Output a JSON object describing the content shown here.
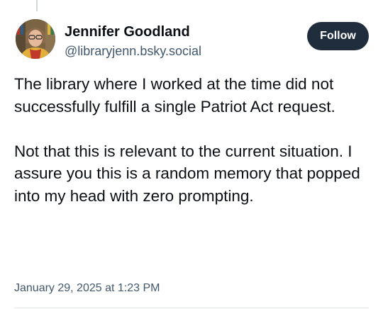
{
  "post": {
    "author": {
      "display_name": "Jennifer Goodland",
      "handle": "@libraryjenn.bsky.social",
      "avatar_icon": "user-avatar"
    },
    "follow_label": "Follow",
    "paragraphs": [
      "The library where I worked at the time did not successfully fulfill a single Patriot Act request.",
      "Not that this is relevant to the current situation. I assure you this is a random memory that popped into my head with zero prompting."
    ],
    "timestamp": "January 29, 2025 at 1:23 PM"
  },
  "colors": {
    "follow_button_bg": "#1f2d3d",
    "handle_text": "#42576c",
    "body_text": "#0b0f14"
  }
}
